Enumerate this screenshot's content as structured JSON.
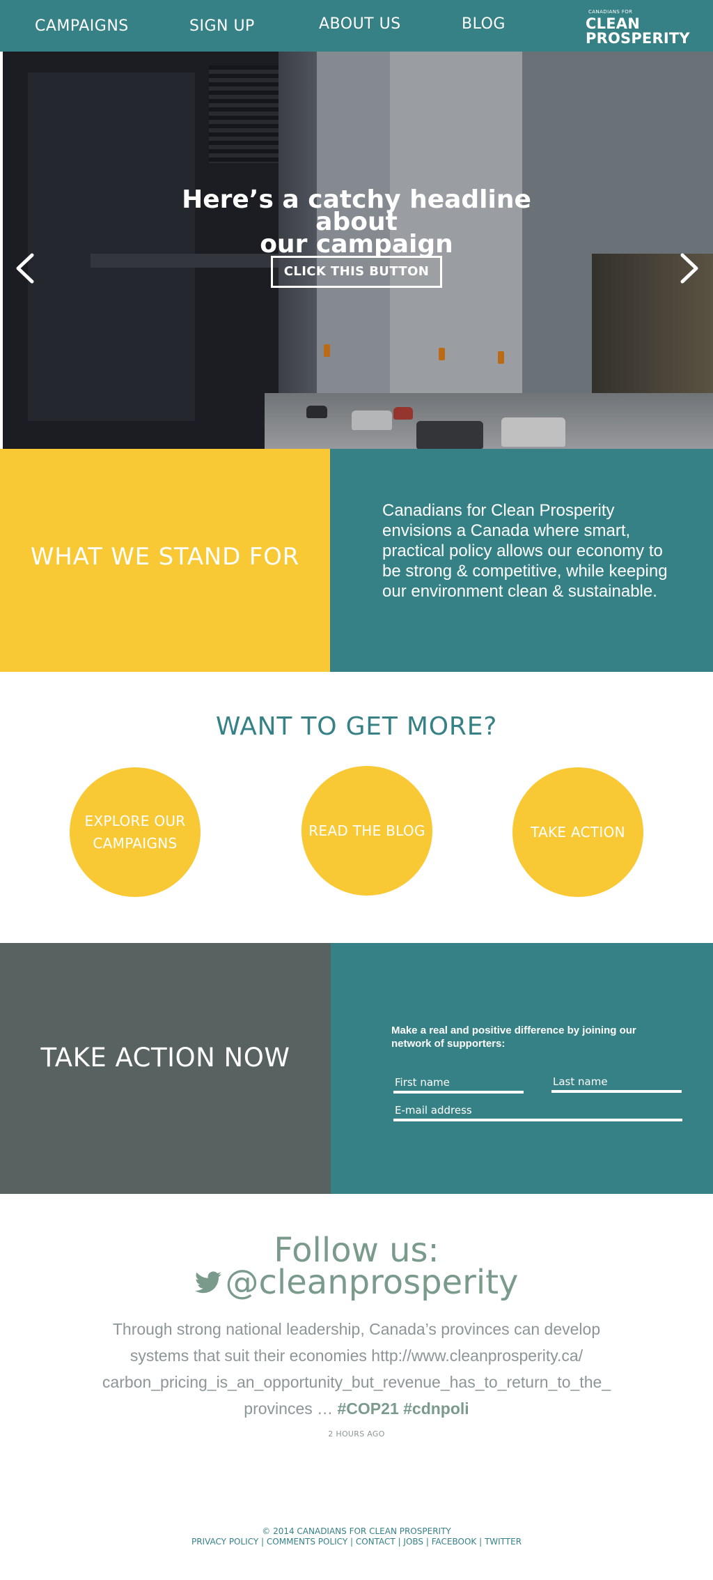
{
  "nav": {
    "items": [
      {
        "label": "CAMPAIGNS"
      },
      {
        "label": "SIGN UP"
      },
      {
        "label": "ABOUT US"
      },
      {
        "label": "BLOG"
      }
    ],
    "logo": {
      "small": "CANADIANS FOR",
      "line1": "CLEAN",
      "line2": "PROSPERITY"
    }
  },
  "hero": {
    "headline_line1": "Here’s a catchy headline about",
    "headline_line2": "our campaign",
    "button_label": "CLICK THIS BUTTON",
    "prev_icon": "chevron-left-icon",
    "next_icon": "chevron-right-icon"
  },
  "stand": {
    "title": "WHAT WE STAND FOR",
    "text": "Canadians for Clean Prosperity envisions a Canada where smart, practical policy allows our economy to be strong & competitive, while keeping our environment clean & sustainable."
  },
  "more": {
    "title": "WANT TO GET MORE?",
    "circles": [
      {
        "line1": "EXPLORE OUR",
        "line2": "CAMPAIGNS"
      },
      {
        "line1": "READ THE BLOG"
      },
      {
        "line1": "TAKE ACTION"
      }
    ]
  },
  "action": {
    "title": "TAKE ACTION NOW",
    "text": "Make a real and positive difference by joining our network of supporters:",
    "first_name": "First name",
    "last_name": "Last name",
    "email": "E-mail address"
  },
  "follow": {
    "title": "Follow us:",
    "handle": "@cleanprosperity",
    "icon": "twitter-bird-icon",
    "tweet_text": "Through strong national leadership, Canada’s provinces can develop systems that suit their economies http://www.cleanprosperity.ca/ carbon_pricing_is_an_opportunity_but_revenue_has_to_return_to_the_ provinces …",
    "hashtag1": "#COP21",
    "hashtag2": "#cdnpoli",
    "time": "2 HOURS AGO"
  },
  "footer": {
    "copyright": "© 2014 CANADIANS FOR CLEAN PROSPERITY",
    "links": [
      {
        "label": "PRIVACY POLICY"
      },
      {
        "label": "COMMENTS POLICY"
      },
      {
        "label": "CONTACT"
      },
      {
        "label": "JOBS"
      },
      {
        "label": "FACEBOOK"
      },
      {
        "label": "TWITTER"
      }
    ],
    "separator": " | "
  },
  "colors": {
    "teal": "#368186",
    "yellow": "#f9c935",
    "slate": "#576261",
    "sage": "#7a9a8c"
  }
}
